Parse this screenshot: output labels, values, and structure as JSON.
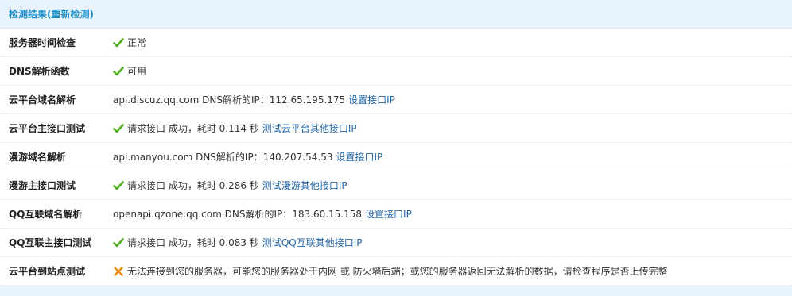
{
  "header": {
    "title": "检测结果",
    "recheck_link": "(重新检测)"
  },
  "rows": [
    {
      "label": "服务器时间检查",
      "status": "ok",
      "icon": "check-icon",
      "text": "正常",
      "link": ""
    },
    {
      "label": "DNS解析函数",
      "status": "ok",
      "icon": "check-icon",
      "text": "可用",
      "link": ""
    },
    {
      "label": "云平台域名解析",
      "status": "none",
      "icon": "",
      "text": "api.discuz.qq.com DNS解析的IP：112.65.195.175",
      "link": "设置接口IP"
    },
    {
      "label": "云平台主接口测试",
      "status": "ok",
      "icon": "check-icon",
      "text": "请求接口 成功，耗时 0.114 秒",
      "link": "测试云平台其他接口IP"
    },
    {
      "label": "漫游域名解析",
      "status": "none",
      "icon": "",
      "text": "api.manyou.com DNS解析的IP：140.207.54.53",
      "link": "设置接口IP"
    },
    {
      "label": "漫游主接口测试",
      "status": "ok",
      "icon": "check-icon",
      "text": "请求接口 成功，耗时 0.286 秒",
      "link": "测试漫游其他接口IP"
    },
    {
      "label": "QQ互联域名解析",
      "status": "none",
      "icon": "",
      "text": "openapi.qzone.qq.com DNS解析的IP：183.60.15.158",
      "link": "设置接口IP"
    },
    {
      "label": "QQ互联主接口测试",
      "status": "ok",
      "icon": "check-icon",
      "text": "请求接口 成功，耗时 0.083 秒",
      "link": "测试QQ互联其他接口IP"
    },
    {
      "label": "云平台到站点测试",
      "status": "error",
      "icon": "cross-icon",
      "text": "无法连接到您的服务器，可能您的服务器处于内网 或 防火墙后端；或您的服务器返回无法解析的数据，请检查程序是否上传完整",
      "link": ""
    }
  ],
  "colors": {
    "ok": "#4cae1f",
    "error": "#f08a10",
    "link": "#2366a8",
    "header_text": "#1c8fc9",
    "header_bg": "#e8f3fd"
  }
}
